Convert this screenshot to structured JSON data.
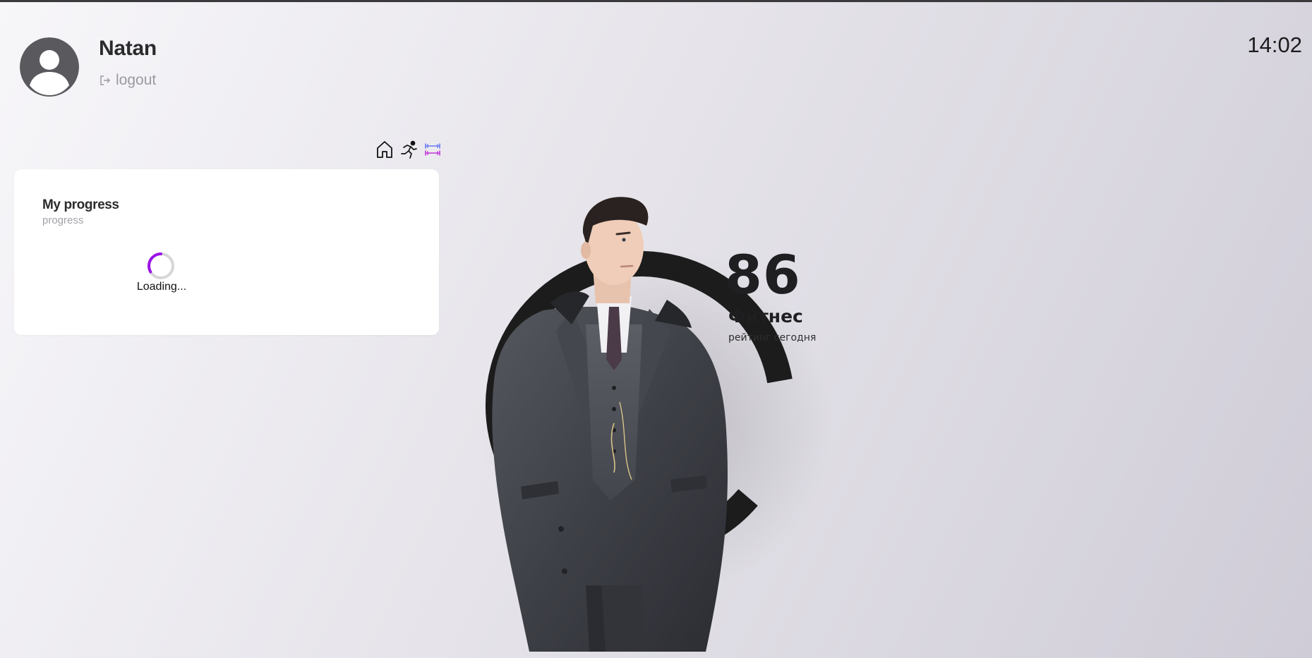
{
  "user": {
    "name": "Natan",
    "avatar_icon": "user-avatar-icon",
    "logout_label": "logout",
    "logout_icon": "logout-icon"
  },
  "clock": {
    "time": "14:02"
  },
  "nav": {
    "items": [
      {
        "icon": "home-icon"
      },
      {
        "icon": "running-icon"
      },
      {
        "icon": "dumbbell-icon"
      }
    ]
  },
  "progress_card": {
    "title": "My progress",
    "subtitle": "progress",
    "loading_text": "Loading...",
    "spinner_color": "#9b12e6"
  },
  "fitness": {
    "score": "86",
    "title": "Фитнес",
    "subtitle": "рейтинг сегодня",
    "ring_fraction": 0.86,
    "ring_color": "#1c1c1c"
  },
  "colors": {
    "background": "#e6e4ea",
    "card": "#ffffff",
    "text_dark": "#2b2b2d",
    "text_muted": "#9a9aa0"
  }
}
